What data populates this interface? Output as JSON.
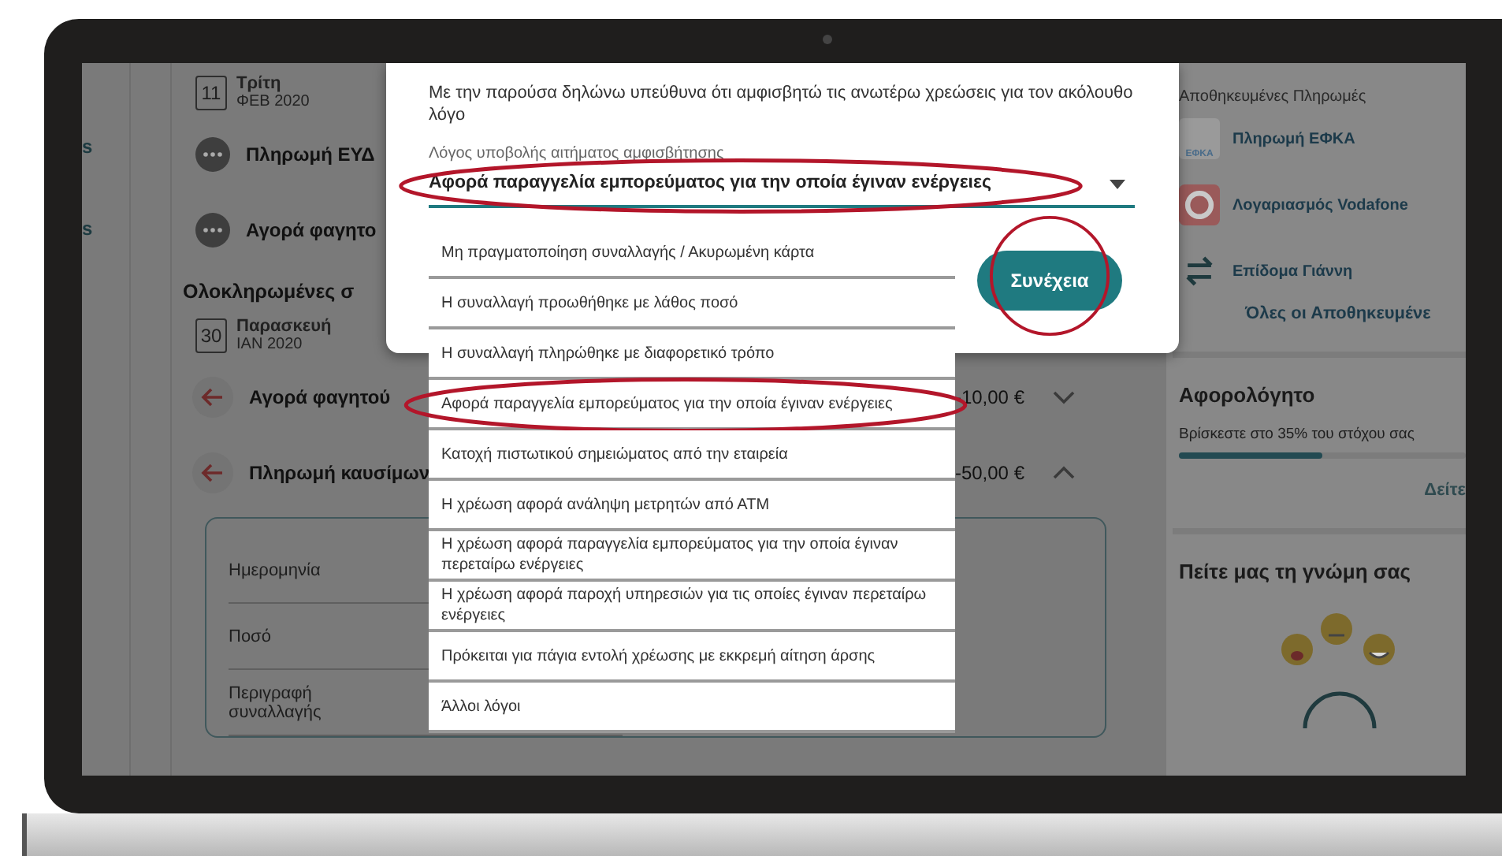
{
  "nav_items": [
    "s",
    "s"
  ],
  "timeline": {
    "pending_date": {
      "day": "11",
      "weekday": "Τρίτη",
      "month": "ΦΕΒ 2020"
    },
    "pending_items": [
      {
        "kind": "pending",
        "title": "Πληρωμή ΕΥΔ"
      },
      {
        "kind": "pending",
        "title": "Αγορά φαγητο"
      }
    ],
    "completed_heading": "Ολοκληρωμένες σ",
    "completed_date": {
      "day": "30",
      "weekday": "Παρασκευή",
      "month": "ΙΑΝ 2020"
    },
    "completed_items": [
      {
        "kind": "outgoing",
        "title": "Αγορά φαγητού",
        "amount": "-10,00 €",
        "expanded": false
      },
      {
        "kind": "outgoing",
        "title": "Πληρωμή καυσίμων",
        "amount": "-50,00 €",
        "expanded": true
      }
    ],
    "details": [
      "Ημερομηνία",
      "Ποσό",
      "Περιγραφή συναλλαγής"
    ]
  },
  "dialog": {
    "text": "Με την παρούσα δηλώνω υπεύθυνα ότι αμφισβητώ τις ανωτέρω χρεώσεις για τον ακόλουθο λόγο",
    "select": {
      "label": "Λόγος υποβολής αιτήματος αμφισβήτησης",
      "value": "Αφορά παραγγελία εμπορεύματος για την οποία έγιναν ενέργειες",
      "highlighted": true
    },
    "button": {
      "label": "Συνέχεια",
      "highlighted": true
    },
    "options": [
      {
        "label": "Μη πραγματοποίηση συναλλαγής / Ακυρωμένη κάρτα",
        "highlighted": false
      },
      {
        "label": "Η συναλλαγή προωθήθηκε με λάθος ποσό",
        "highlighted": false
      },
      {
        "label": "Η συναλλαγή πληρώθηκε με διαφορετικό τρόπο",
        "highlighted": false
      },
      {
        "label": "Αφορά παραγγελία εμπορεύματος για την οποία έγιναν ενέργειες",
        "highlighted": true
      },
      {
        "label": "Κατοχή πιστωτικού σημειώματος από την εταιρεία",
        "highlighted": false
      },
      {
        "label": "Η χρέωση αφορά ανάληψη μετρητών από ΑΤΜ",
        "highlighted": false
      },
      {
        "label": "Η χρέωση αφορά παραγγελία εμπορεύματος για την οποία έγιναν περεταίρω ενέργειες",
        "highlighted": false
      },
      {
        "label": "Η χρέωση αφορά παροχή υπηρεσιών για τις οποίες έγιναν περεταίρω ενέργειες",
        "highlighted": false
      },
      {
        "label": "Πρόκειται για πάγια εντολή χρέωσης με εκκρεμή αίτηση άρσης",
        "highlighted": false
      },
      {
        "label": "Άλλοι λόγοι",
        "highlighted": false
      }
    ]
  },
  "sidebar": {
    "saved_title": "Αποθηκευμένες Πληρωμές",
    "saved": [
      {
        "kind": "efka",
        "logo_text": "ΕΦΚΑ",
        "label": "Πληρωμή ΕΦΚΑ"
      },
      {
        "kind": "vodafone",
        "label": "Λογαριασμός Vodafone"
      },
      {
        "kind": "transfer",
        "label": "Επίδομα Γιάννη"
      }
    ],
    "all_link": "Όλες οι Αποθηκευμένε",
    "tax": {
      "title": "Αφορολόγητο",
      "text": "Βρίσκεστε στο 35% του στόχου σας",
      "level": 0.5,
      "link": "Δείτε"
    },
    "feedback_title": "Πείτε μας τη γνώμη σας"
  }
}
